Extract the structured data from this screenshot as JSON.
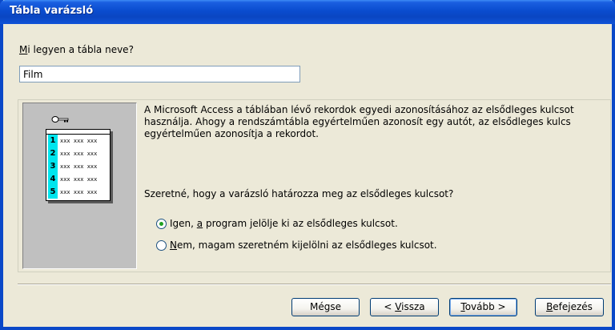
{
  "window": {
    "title": "Tábla varázsló"
  },
  "name_field": {
    "label_accel": "M",
    "label_rest": "i legyen a tábla neve?",
    "value": "Film"
  },
  "illustration": {
    "rows": [
      "1",
      "2",
      "3",
      "4",
      "5"
    ],
    "cell_text": "xxx xxx xxx"
  },
  "description": "A Microsoft Access a táblában lévő rekordok egyedi azonosításához az elsődleges kulcsot használja. Ahogy a rendszámtábla egyértelműen azonosít egy autót, az elsődleges kulcs egyértelműen azonosítja a rekordot.",
  "question": "Szeretné, hogy a varázsló határozza meg az elsődleges kulcsot?",
  "options": [
    {
      "pre": "Igen, ",
      "accel": "a",
      "post": " program jelölje ki az elsődleges kulcsot.",
      "checked": true
    },
    {
      "pre": "",
      "accel": "N",
      "post": "em, magam szeretném kijelölni az elsődleges kulcsot.",
      "checked": false
    }
  ],
  "buttons": {
    "cancel": {
      "pre": "Mégse",
      "accel": "",
      "post": ""
    },
    "back": {
      "pre": "< ",
      "accel": "V",
      "post": "issza"
    },
    "next": {
      "pre": "",
      "accel": "T",
      "post": "ovább >"
    },
    "finish": {
      "pre": "",
      "accel": "B",
      "post": "efejezés"
    }
  },
  "colors": {
    "titlebar": "#0a4ccf",
    "row_number_bg": "#00e5ee",
    "radio_dot": "#21a121"
  }
}
